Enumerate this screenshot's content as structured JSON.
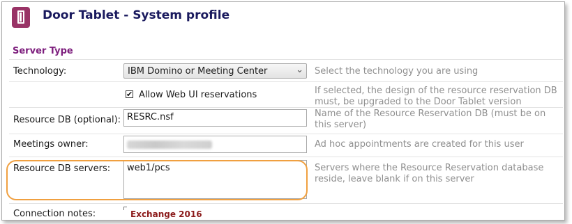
{
  "header": {
    "title": "Door Tablet - System profile",
    "logo_icon": "door-icon"
  },
  "section": {
    "title": "Server Type"
  },
  "fields": {
    "technology": {
      "label": "Technology:",
      "value": "IBM Domino or Meeting Center",
      "help": "Select the technology you are using"
    },
    "web_ui": {
      "checkbox_label": "Allow Web UI reservations",
      "checked": true,
      "help": "If selected, the design of the resource reservation DB must, be upgraded to the Door Tablet version"
    },
    "resource_db": {
      "label": "Resource DB (optional):",
      "value": "RESRC.nsf",
      "help": "Name of the Resource Reservation DB (must be on this server)"
    },
    "meetings_owner": {
      "label": "Meetings owner:",
      "help": "Ad hoc appointments are created for this user"
    },
    "resource_db_servers": {
      "label": "Resource DB servers:",
      "value": "web1/pcs",
      "help": "Servers where the Resource Reservation database reside, leave blank if on this server"
    },
    "connection_notes": {
      "label": "Connection notes:",
      "value": "Exchange 2016"
    }
  },
  "colors": {
    "title": "#1a1a5e",
    "section": "#7d1e7d",
    "logo": "#993366",
    "highlight": "#f0a040",
    "notes": "#8b1a1a"
  }
}
